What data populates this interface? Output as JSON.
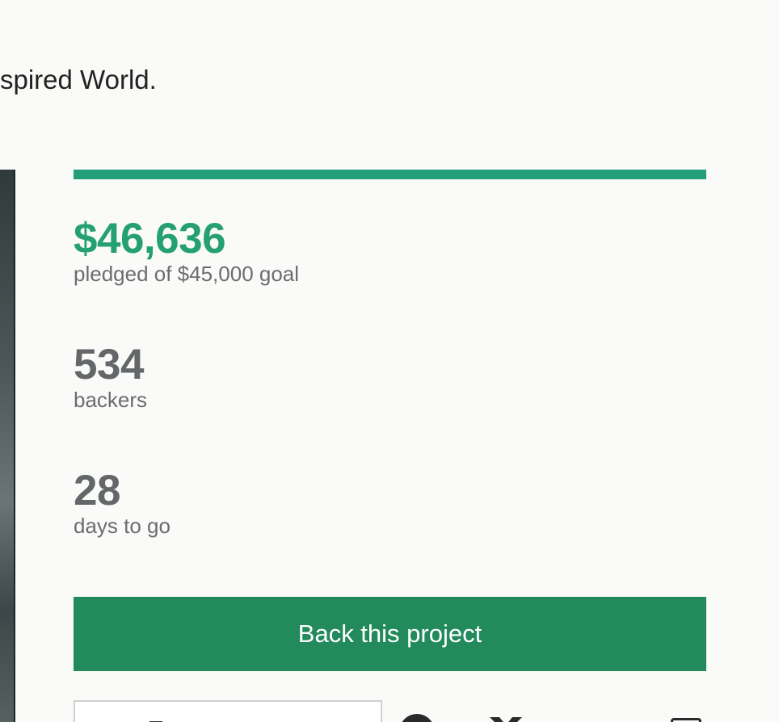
{
  "header": {
    "subtitle_fragment": "spired World."
  },
  "funding": {
    "progress_fraction": 1.0,
    "progress_color": "#229e78",
    "pledged_amount": "$46,636",
    "pledged_label": "pledged of $45,000 goal",
    "backers_count": "534",
    "backers_label": "backers",
    "days_count": "28",
    "days_label": "days to go"
  },
  "actions": {
    "back_button_label": "Back this project",
    "back_button_color": "#228a5b"
  },
  "share": {
    "icons": [
      "bookmark-icon",
      "facebook-icon",
      "twitter-icon",
      "email-icon"
    ]
  }
}
